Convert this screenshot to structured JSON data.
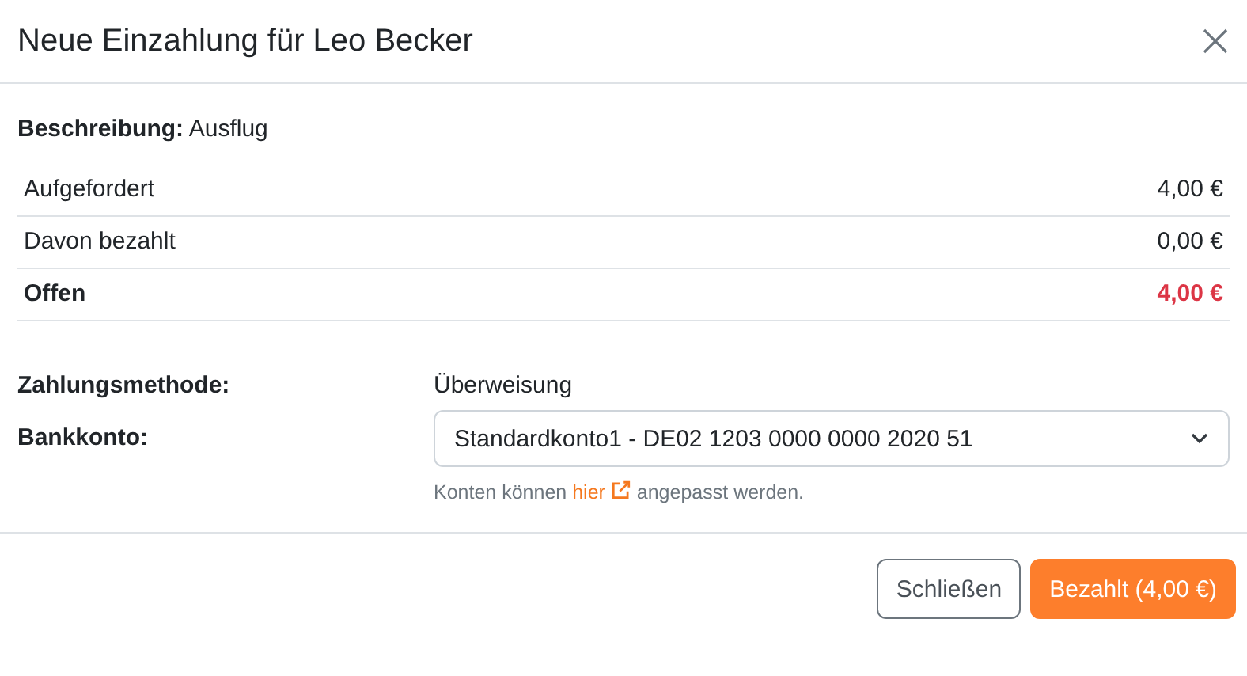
{
  "dialog": {
    "title": "Neue Einzahlung für Leo Becker"
  },
  "description": {
    "label": "Beschreibung:",
    "value": "Ausflug"
  },
  "summary": [
    {
      "kind": "plain",
      "label": "Aufgefordert",
      "amount": "4,00 €"
    },
    {
      "kind": "plain",
      "label": "Davon bezahlt",
      "amount": "0,00 €"
    },
    {
      "kind": "total",
      "label": "Offen",
      "amount": "4,00 €"
    }
  ],
  "payment_method": {
    "label": "Zahlungsmethode:",
    "value": "Überweisung"
  },
  "bank_account": {
    "label": "Bankkonto:",
    "value": "Standardkonto1 - DE02 1203 0000 0000 2020 51",
    "hint": {
      "before": "Konten können",
      "link": "hier",
      "after": "angepasst werden."
    }
  },
  "buttons": [
    {
      "kind": "secondary",
      "label": "Schließen"
    },
    {
      "kind": "primary",
      "label": "Bezahlt (4,00 €)"
    }
  ]
}
